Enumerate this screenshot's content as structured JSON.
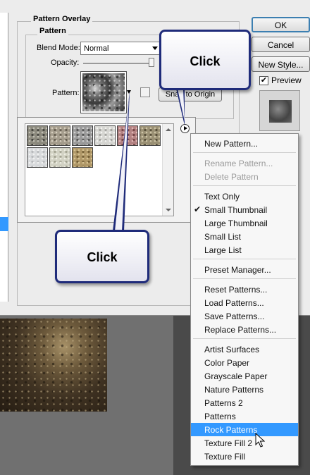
{
  "dialog": {
    "section_title": "Pattern Overlay",
    "group_title": "Pattern",
    "blend_mode_label": "Blend Mode:",
    "blend_mode_value": "Normal",
    "opacity_label": "Opacity:",
    "opacity_value": 1.0,
    "pattern_label": "Pattern:",
    "snap_origin_label": "Snap to Origin",
    "ok_label": "OK",
    "cancel_label": "Cancel",
    "new_style_label": "New Style...",
    "preview_label": "Preview",
    "preview_checked": true
  },
  "picker": {
    "patterns": [
      {
        "name": "pattern-1",
        "colors": [
          "#8c8a7e",
          "#3e3d38",
          "#c2c0b4"
        ]
      },
      {
        "name": "pattern-2",
        "colors": [
          "#a49c8c",
          "#5f574a",
          "#d8d0c0"
        ]
      },
      {
        "name": "pattern-3",
        "colors": [
          "#9a9a9a",
          "#4c4c4c",
          "#d0d0d0"
        ]
      },
      {
        "name": "pattern-4",
        "colors": [
          "#d6d6d2",
          "#9d9d98",
          "#f4f4f2"
        ]
      },
      {
        "name": "pattern-5",
        "colors": [
          "#b38282",
          "#6e3e40",
          "#e2b8b6"
        ]
      },
      {
        "name": "pattern-6",
        "colors": [
          "#9a9074",
          "#4e4632",
          "#cfc6a8"
        ]
      },
      {
        "name": "pattern-7",
        "colors": [
          "#d8dadc",
          "#b4b6b8",
          "#f2f2f2"
        ]
      },
      {
        "name": "pattern-8",
        "colors": [
          "#d2d2c4",
          "#9e9e8c",
          "#efefe4"
        ]
      },
      {
        "name": "pattern-9",
        "colors": [
          "#b09868",
          "#6e5a32",
          "#d8c494"
        ]
      }
    ]
  },
  "menu": {
    "items": [
      {
        "label": "New Pattern...",
        "disabled": false,
        "checked": false,
        "highlighted": false
      },
      {
        "separator": true
      },
      {
        "label": "Rename Pattern...",
        "disabled": true,
        "checked": false,
        "highlighted": false
      },
      {
        "label": "Delete Pattern",
        "disabled": true,
        "checked": false,
        "highlighted": false
      },
      {
        "separator": true
      },
      {
        "label": "Text Only",
        "disabled": false,
        "checked": false,
        "highlighted": false
      },
      {
        "label": "Small Thumbnail",
        "disabled": false,
        "checked": true,
        "highlighted": false
      },
      {
        "label": "Large Thumbnail",
        "disabled": false,
        "checked": false,
        "highlighted": false
      },
      {
        "label": "Small List",
        "disabled": false,
        "checked": false,
        "highlighted": false
      },
      {
        "label": "Large List",
        "disabled": false,
        "checked": false,
        "highlighted": false
      },
      {
        "separator": true
      },
      {
        "label": "Preset Manager...",
        "disabled": false,
        "checked": false,
        "highlighted": false
      },
      {
        "separator": true
      },
      {
        "label": "Reset Patterns...",
        "disabled": false,
        "checked": false,
        "highlighted": false
      },
      {
        "label": "Load Patterns...",
        "disabled": false,
        "checked": false,
        "highlighted": false
      },
      {
        "label": "Save Patterns...",
        "disabled": false,
        "checked": false,
        "highlighted": false
      },
      {
        "label": "Replace Patterns...",
        "disabled": false,
        "checked": false,
        "highlighted": false
      },
      {
        "separator": true
      },
      {
        "label": "Artist Surfaces",
        "disabled": false,
        "checked": false,
        "highlighted": false
      },
      {
        "label": "Color Paper",
        "disabled": false,
        "checked": false,
        "highlighted": false
      },
      {
        "label": "Grayscale Paper",
        "disabled": false,
        "checked": false,
        "highlighted": false
      },
      {
        "label": "Nature Patterns",
        "disabled": false,
        "checked": false,
        "highlighted": false
      },
      {
        "label": "Patterns 2",
        "disabled": false,
        "checked": false,
        "highlighted": false
      },
      {
        "label": "Patterns",
        "disabled": false,
        "checked": false,
        "highlighted": false
      },
      {
        "label": "Rock Patterns",
        "disabled": false,
        "checked": false,
        "highlighted": true
      },
      {
        "label": "Texture Fill 2",
        "disabled": false,
        "checked": false,
        "highlighted": false
      },
      {
        "label": "Texture Fill",
        "disabled": false,
        "checked": false,
        "highlighted": false
      }
    ]
  },
  "callouts": {
    "top": "Click",
    "bottom": "Click",
    "border_color": "#1f2b7a"
  },
  "colors": {
    "highlight": "#3399ff",
    "dialog_bg": "#ececec"
  }
}
